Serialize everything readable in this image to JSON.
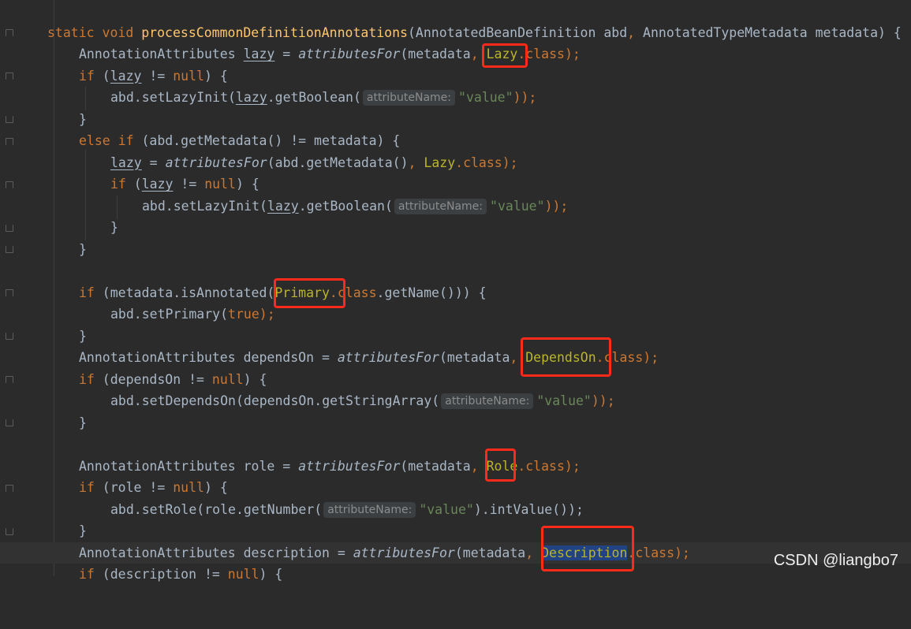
{
  "editor": {
    "lines": {
      "l1": {
        "static_kw": "static",
        "void_kw": "void",
        "method_name": "processCommonDefinitionAnnotations",
        "open_paren": "(AnnotatedBeanDefinition abd",
        "comma": ",",
        "param2": " AnnotatedTypeMetadata metadata) {"
      },
      "l2": {
        "type": "AnnotationAttributes ",
        "var": "lazy",
        "eq": " = ",
        "call": "attributesFor",
        "args_a": "(metadata",
        "comma": ",",
        "ann": "Lazy",
        "dot": ".",
        "cls": "class",
        "end": ");"
      },
      "l3": {
        "if_kw": "if",
        "paren": " (",
        "var": "lazy",
        "op": " != ",
        "null_kw": "null",
        "end": ") {"
      },
      "l4": {
        "call_a": "abd.setLazyInit(",
        "var": "lazy",
        "call_b": ".getBoolean(",
        "hint": "attributeName:",
        "str": "\"value\"",
        "end": "));"
      },
      "l5": {
        "brace": "}"
      },
      "l6": {
        "else_kw": "else",
        "if_kw": "if",
        "rest": " (abd.getMetadata() != metadata) {"
      },
      "l7": {
        "var": "lazy",
        "eq": " = ",
        "call": "attributesFor",
        "args_a": "(abd.getMetadata()",
        "comma": ",",
        "ann": " Lazy",
        "dot": ".",
        "cls": "class",
        "end": ");"
      },
      "l8": {
        "if_kw": "if",
        "paren": " (",
        "var": "lazy",
        "op": " != ",
        "null_kw": "null",
        "end": ") {"
      },
      "l9": {
        "call_a": "abd.setLazyInit(",
        "var": "lazy",
        "call_b": ".getBoolean(",
        "hint": "attributeName:",
        "str": "\"value\"",
        "end": "));"
      },
      "l10": {
        "brace": "}"
      },
      "l11": {
        "brace": "}"
      },
      "l13": {
        "if_kw": "if",
        "rest": " (metadata.isAnnotated(",
        "ann": "Primary",
        "dot": ".",
        "cls": "class",
        "end": ".getName())) {"
      },
      "l14": {
        "call": "abd.setPrimary(",
        "true_kw": "true",
        "end": ");"
      },
      "l15": {
        "brace": "}"
      },
      "l16": {
        "type": "AnnotationAttributes dependsOn = ",
        "call": "attributesFor",
        "args_a": "(metadata",
        "comma": ",",
        "ann": " DependsOn",
        "dot": ".",
        "cls": "class",
        "end": ");"
      },
      "l17": {
        "if_kw": "if",
        "rest": " (dependsOn != ",
        "null_kw": "null",
        "end": ") {"
      },
      "l18": {
        "call": "abd.setDependsOn(dependsOn.getStringArray(",
        "hint": "attributeName:",
        "str": "\"value\"",
        "end": "));"
      },
      "l19": {
        "brace": "}"
      },
      "l21": {
        "type": "AnnotationAttributes role = ",
        "call": "attributesFor",
        "args_a": "(metadata",
        "comma": ",",
        "ann": " Role",
        "dot": ".",
        "cls": "class",
        "end": ");"
      },
      "l22": {
        "if_kw": "if",
        "rest": " (role != ",
        "null_kw": "null",
        "end": ") {"
      },
      "l23": {
        "call": "abd.setRole(role.getNumber(",
        "hint": "attributeName:",
        "str": "\"value\"",
        "end": ").intValue());"
      },
      "l24": {
        "brace": "}"
      },
      "l25": {
        "type": "AnnotationAttributes description = ",
        "call": "attributesFor",
        "args_a": "(metadata",
        "comma": ",",
        "space": " ",
        "ann": "Description",
        "dot": ".",
        "cls": "class",
        "end": ");"
      },
      "l26": {
        "if_kw": "if",
        "rest": " (description != ",
        "null_kw": "null",
        "end": ") {"
      }
    }
  },
  "watermark": "CSDN @liangbo7",
  "colors": {
    "background": "#2b2b2b",
    "keyword": "#cc7832",
    "method_decl": "#ffc66d",
    "annotation": "#bbb529",
    "string": "#6a8759",
    "highlight_box": "#ff2a1a",
    "selection": "#214283"
  }
}
